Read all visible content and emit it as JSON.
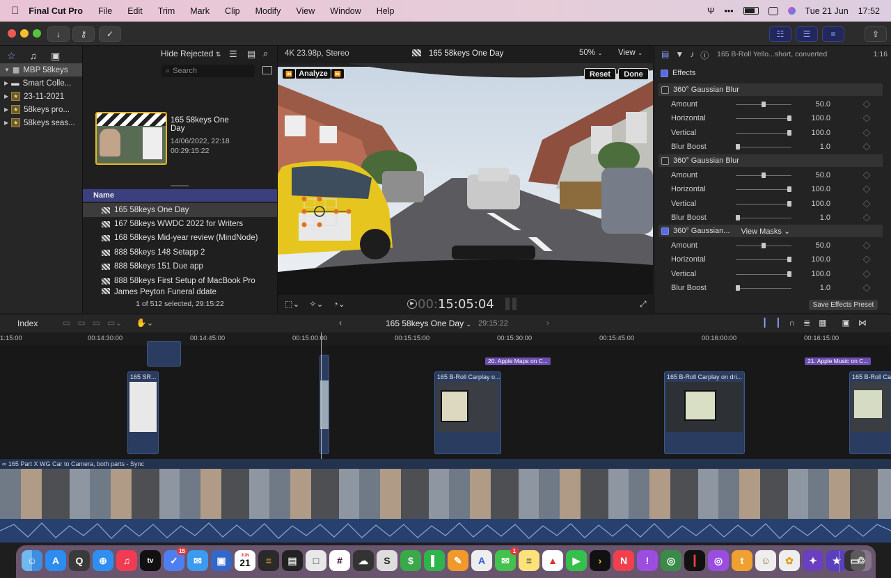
{
  "menubar": {
    "app": "Final Cut Pro",
    "menus": [
      "File",
      "Edit",
      "Trim",
      "Mark",
      "Clip",
      "Modify",
      "View",
      "Window",
      "Help"
    ],
    "date": "Tue 21 Jun",
    "time": "17:52"
  },
  "browser": {
    "hide_rejected": "Hide Rejected",
    "search_placeholder": "Search",
    "libraries": [
      {
        "label": "MBP 58keys"
      },
      {
        "label": "Smart Colle..."
      },
      {
        "label": "23-11-2021"
      },
      {
        "label": "58keys pro..."
      },
      {
        "label": "58keys seas..."
      }
    ],
    "preview": {
      "title": "165 58keys One Day",
      "date": "14/06/2022, 22:18",
      "duration": "00:29:15:22"
    },
    "column_header": "Name",
    "clips": [
      "165 58keys One Day",
      "167 58keys WWDC 2022 for Writers",
      "168 58keys Mid-year review (MindNode)",
      "888 58keys 148 Setapp 2",
      "888 58keys 151 Due app",
      "888 58keys First Setup of MacBook Pro",
      "James Peyton Funeral ddate"
    ],
    "status": "1 of 512 selected, 29:15:22"
  },
  "viewer": {
    "format": "4K 23.98p, Stereo",
    "title": "165 58keys One Day",
    "zoom": "50%",
    "view": "View",
    "analyze": "Analyze",
    "reset": "Reset",
    "done": "Done",
    "timecode_dim": "00:",
    "timecode": "15:05:04"
  },
  "inspector": {
    "clip_name": "165 B-Roll Yello...short, converted",
    "clip_time": "1:16",
    "effects_label": "Effects",
    "save_preset": "Save Effects Preset",
    "effects": [
      {
        "name": "360° Gaussian Blur",
        "checked": false,
        "extra": "",
        "params": [
          {
            "label": "Amount",
            "value": "50.0",
            "level": 0.5
          },
          {
            "label": "Horizontal",
            "value": "100.0",
            "level": 1.0
          },
          {
            "label": "Vertical",
            "value": "100.0",
            "level": 1.0
          },
          {
            "label": "Blur Boost",
            "value": "1.0",
            "level": 0.0
          }
        ]
      },
      {
        "name": "360° Gaussian Blur",
        "checked": false,
        "extra": "",
        "params": [
          {
            "label": "Amount",
            "value": "50.0",
            "level": 0.5
          },
          {
            "label": "Horizontal",
            "value": "100.0",
            "level": 1.0
          },
          {
            "label": "Vertical",
            "value": "100.0",
            "level": 1.0
          },
          {
            "label": "Blur Boost",
            "value": "1.0",
            "level": 0.0
          }
        ]
      },
      {
        "name": "360° Gaussian...",
        "checked": true,
        "extra": "View Masks",
        "params": [
          {
            "label": "Amount",
            "value": "50.0",
            "level": 0.5
          },
          {
            "label": "Horizontal",
            "value": "100.0",
            "level": 1.0
          },
          {
            "label": "Vertical",
            "value": "100.0",
            "level": 1.0
          },
          {
            "label": "Blur Boost",
            "value": "1.0",
            "level": 0.0
          }
        ]
      }
    ]
  },
  "timeline": {
    "index": "Index",
    "project": "165 58keys One Day",
    "duration": "29:15:22",
    "ruler": [
      "1:15:00",
      "00:14:30:00",
      "00:14:45:00",
      "00:15:00:00",
      "00:15:15:00",
      "00:15:30:00",
      "00:15:45:00",
      "00:16:00:00",
      "00:16:15:00"
    ],
    "markers": [
      "20. Apple Maps on C...",
      "21. Apple Music on C..."
    ],
    "connected_clips": [
      "165 SR...",
      "165 B-Roll Carplay o...",
      "165 B-Roll Carplay on dri...",
      "165 B-Roll Carp..."
    ],
    "storyline": "165 Part X WG Car to Camera, both parts - Sync"
  },
  "dock": {
    "calendar_month": "JUN",
    "calendar_day": "21",
    "badge_things": "15",
    "badge_messages": "1"
  },
  "colors": {
    "accent": "#5a6ae0",
    "storyline": "#22324f",
    "marker": "#6c4fb0"
  }
}
